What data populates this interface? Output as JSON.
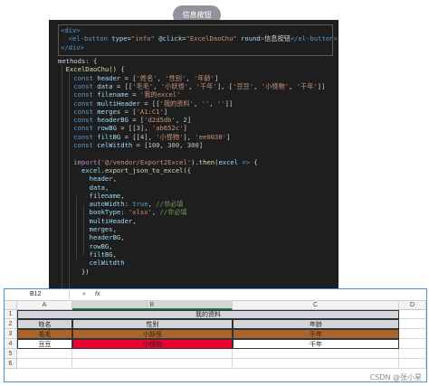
{
  "button": {
    "label": "信息按钮",
    "color": "#909399"
  },
  "code": {
    "template": [
      [
        [
          "tag",
          "<div>"
        ]
      ],
      [
        [
          "tag",
          "  <el-button "
        ],
        [
          "attr",
          "type"
        ],
        [
          "txt",
          "="
        ],
        [
          "str",
          "\"info\""
        ],
        [
          "txt",
          " "
        ],
        [
          "attr",
          "@click"
        ],
        [
          "txt",
          "="
        ],
        [
          "str",
          "\"ExcelDaoChu\""
        ],
        [
          "txt",
          " "
        ],
        [
          "attr",
          "round"
        ],
        [
          "tag",
          ">"
        ],
        [
          "txt",
          "信息按钮"
        ],
        [
          "tag",
          "</el-button>"
        ]
      ],
      [
        [
          "tag",
          "</div>"
        ]
      ]
    ],
    "script": [
      [
        [
          "txt",
          "methods: {"
        ]
      ],
      [
        [
          "fn",
          "  ExcelDaoChu"
        ],
        [
          "txt",
          "() {"
        ]
      ],
      [
        [
          "kw",
          "    const "
        ],
        [
          "var",
          "header"
        ],
        [
          "txt",
          " = ["
        ],
        [
          "str",
          "'姓名'"
        ],
        [
          "txt",
          ", "
        ],
        [
          "str",
          "'性别'"
        ],
        [
          "txt",
          ", "
        ],
        [
          "str",
          "'年龄'"
        ],
        [
          "txt",
          "]"
        ]
      ],
      [
        [
          "kw",
          "    const "
        ],
        [
          "var",
          "data"
        ],
        [
          "txt",
          " = [["
        ],
        [
          "str",
          "'毛毛'"
        ],
        [
          "txt",
          ", "
        ],
        [
          "str",
          "'小妖怪'"
        ],
        [
          "txt",
          ", "
        ],
        [
          "str",
          "'千年'"
        ],
        [
          "txt",
          "], ["
        ],
        [
          "str",
          "'豆豆'"
        ],
        [
          "txt",
          ", "
        ],
        [
          "str",
          "'小怪物'"
        ],
        [
          "txt",
          ", "
        ],
        [
          "str",
          "'千年'"
        ],
        [
          "txt",
          "]]"
        ]
      ],
      [
        [
          "kw",
          "    const "
        ],
        [
          "var",
          "filename"
        ],
        [
          "txt",
          " = "
        ],
        [
          "str",
          "'我的excel'"
        ]
      ],
      [
        [
          "kw",
          "    const "
        ],
        [
          "var",
          "multiHeader"
        ],
        [
          "txt",
          " = [["
        ],
        [
          "str",
          "'我的资料'"
        ],
        [
          "txt",
          ", "
        ],
        [
          "str",
          "''"
        ],
        [
          "txt",
          ", "
        ],
        [
          "str",
          "''"
        ],
        [
          "txt",
          "]]"
        ]
      ],
      [
        [
          "kw",
          "    const "
        ],
        [
          "var",
          "merges"
        ],
        [
          "txt",
          " = ["
        ],
        [
          "str",
          "'A1:C1'"
        ],
        [
          "txt",
          "]"
        ]
      ],
      [
        [
          "kw",
          "    const "
        ],
        [
          "var",
          "headerBG"
        ],
        [
          "txt",
          " = ["
        ],
        [
          "str",
          "'d2d5db'"
        ],
        [
          "txt",
          ", "
        ],
        [
          "num",
          "2"
        ],
        [
          "txt",
          "]"
        ]
      ],
      [
        [
          "kw",
          "    const "
        ],
        [
          "var",
          "rowBG"
        ],
        [
          "txt",
          " = [["
        ],
        [
          "num",
          "3"
        ],
        [
          "txt",
          "], "
        ],
        [
          "str",
          "'ab652c'"
        ],
        [
          "txt",
          "]"
        ]
      ],
      [
        [
          "kw",
          "    const "
        ],
        [
          "var",
          "filtBG"
        ],
        [
          "txt",
          " = [["
        ],
        [
          "num",
          "4"
        ],
        [
          "txt",
          "], "
        ],
        [
          "str",
          "'小怪物'"
        ],
        [
          "txt",
          "], "
        ],
        [
          "str",
          "'ee0030'"
        ],
        [
          "txt",
          "]"
        ]
      ],
      [
        [
          "kw",
          "    const "
        ],
        [
          "var",
          "celWitdth"
        ],
        [
          "txt",
          " = ["
        ],
        [
          "num",
          "100"
        ],
        [
          "txt",
          ", "
        ],
        [
          "num",
          "300"
        ],
        [
          "txt",
          ", "
        ],
        [
          "num",
          "300"
        ],
        [
          "txt",
          "]"
        ]
      ],
      [
        [
          "txt",
          ""
        ]
      ],
      [
        [
          "ctrl",
          "    import"
        ],
        [
          "txt",
          "("
        ],
        [
          "str",
          "'@/vendor/Export2Excel'"
        ],
        [
          "txt",
          ")."
        ],
        [
          "fn",
          "then"
        ],
        [
          "txt",
          "("
        ],
        [
          "var",
          "excel"
        ],
        [
          "kw",
          " =>"
        ],
        [
          "txt",
          " {"
        ]
      ],
      [
        [
          "var",
          "      excel"
        ],
        [
          "txt",
          "."
        ],
        [
          "fn",
          "export_json_to_excel"
        ],
        [
          "txt",
          "({"
        ]
      ],
      [
        [
          "var",
          "        header"
        ],
        [
          "txt",
          ","
        ]
      ],
      [
        [
          "var",
          "        data"
        ],
        [
          "txt",
          ","
        ]
      ],
      [
        [
          "var",
          "        filename"
        ],
        [
          "txt",
          ","
        ]
      ],
      [
        [
          "var",
          "        autoWidth"
        ],
        [
          "txt",
          ": "
        ],
        [
          "kw",
          "true"
        ],
        [
          "txt",
          ", "
        ],
        [
          "cmt",
          "//非必填"
        ]
      ],
      [
        [
          "var",
          "        bookType"
        ],
        [
          "txt",
          ": "
        ],
        [
          "str",
          "'xlsx'"
        ],
        [
          "txt",
          ", "
        ],
        [
          "cmt",
          "//非必填"
        ]
      ],
      [
        [
          "var",
          "        multiHeader"
        ],
        [
          "txt",
          ","
        ]
      ],
      [
        [
          "var",
          "        merges"
        ],
        [
          "txt",
          ","
        ]
      ],
      [
        [
          "var",
          "        headerBG"
        ],
        [
          "txt",
          ","
        ]
      ],
      [
        [
          "var",
          "        rowBG"
        ],
        [
          "txt",
          ","
        ]
      ],
      [
        [
          "var",
          "        filtBG"
        ],
        [
          "txt",
          ","
        ]
      ],
      [
        [
          "var",
          "        celWitdth"
        ]
      ],
      [
        [
          "txt",
          "      })"
        ]
      ]
    ]
  },
  "sheet": {
    "name_box": "B12",
    "fx_label": "fx",
    "columns": [
      "A",
      "B",
      "C",
      "D"
    ],
    "rows": [
      "1",
      "2",
      "3",
      "4",
      "5",
      "6"
    ],
    "merged_title": "我的资料",
    "header": [
      "姓名",
      "性别",
      "年龄"
    ],
    "data": [
      [
        "毛毛",
        "小妖怪",
        "千年"
      ],
      [
        "豆豆",
        "小怪物",
        "千年"
      ]
    ],
    "colors": {
      "header_bg": "#d2d5db",
      "row3_bg": "#ab652c",
      "filt_bg": "#ee0030",
      "selected_col": "#217346"
    }
  },
  "watermark": "CSDN @张小星"
}
